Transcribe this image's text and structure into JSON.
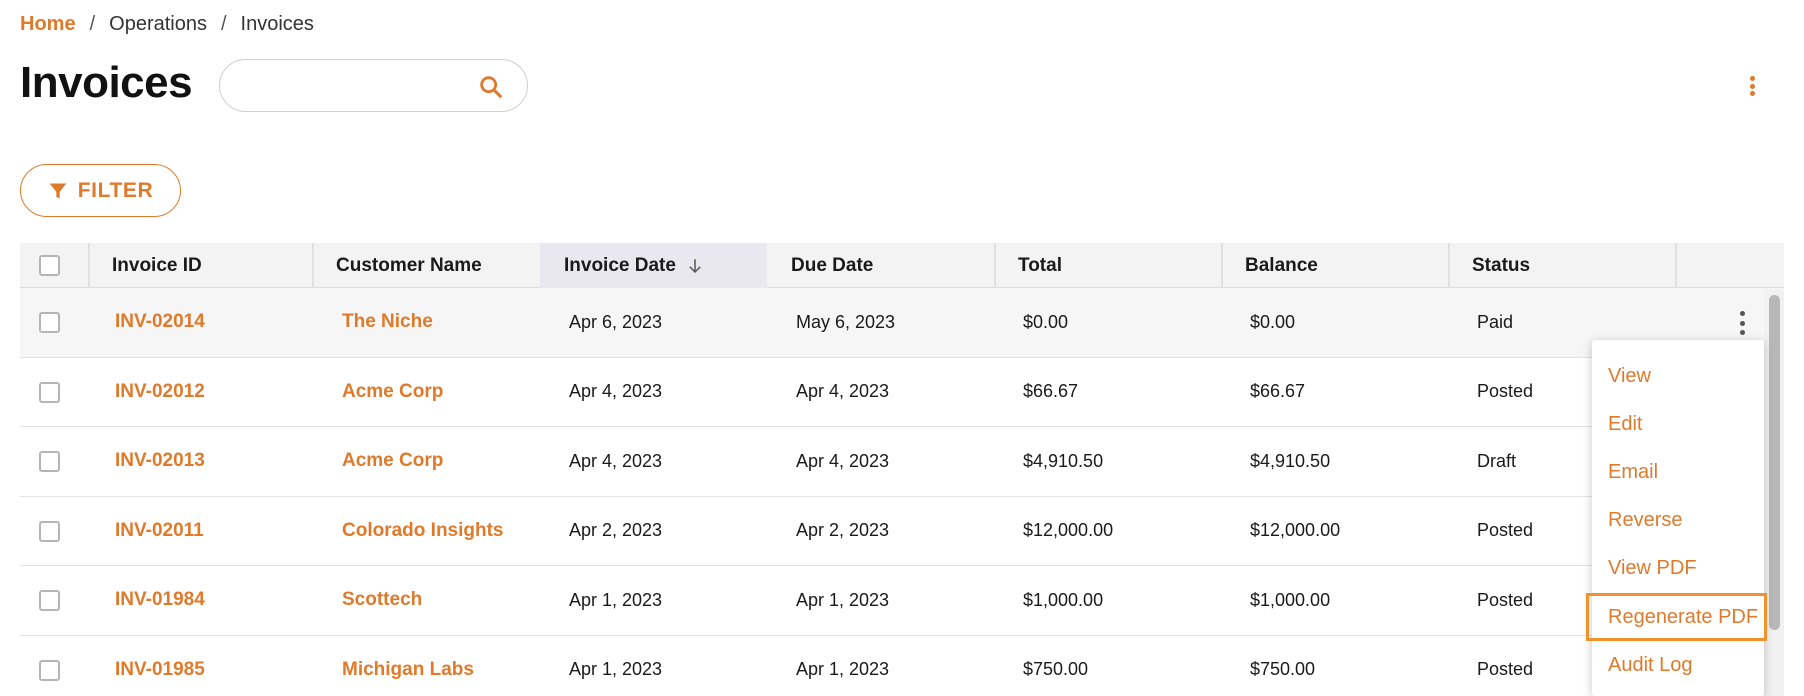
{
  "breadcrumb": {
    "home": "Home",
    "separator": "/",
    "items": [
      "Operations",
      "Invoices"
    ]
  },
  "page": {
    "title": "Invoices"
  },
  "search": {
    "value": "",
    "placeholder": "",
    "icon": "search-icon"
  },
  "filter": {
    "label": "FILTER",
    "icon": "filter-icon"
  },
  "colors": {
    "accent": "#e07a2b",
    "focus_border": "#f0932b",
    "header_bg": "#f3f3f3",
    "sorted_header_bg": "#e8e8ee"
  },
  "table": {
    "columns": [
      "Invoice ID",
      "Customer Name",
      "Invoice Date",
      "Due Date",
      "Total",
      "Balance",
      "Status"
    ],
    "sorted_column": "Invoice Date",
    "sort_direction": "descending",
    "rows": [
      {
        "id": "INV-02014",
        "customer": "The Niche",
        "invoice_date": "Apr 6, 2023",
        "due_date": "May 6, 2023",
        "total": "$0.00",
        "balance": "$0.00",
        "status": "Paid"
      },
      {
        "id": "INV-02012",
        "customer": "Acme Corp",
        "invoice_date": "Apr 4, 2023",
        "due_date": "Apr 4, 2023",
        "total": "$66.67",
        "balance": "$66.67",
        "status": "Posted"
      },
      {
        "id": "INV-02013",
        "customer": "Acme Corp",
        "invoice_date": "Apr 4, 2023",
        "due_date": "Apr 4, 2023",
        "total": "$4,910.50",
        "balance": "$4,910.50",
        "status": "Draft"
      },
      {
        "id": "INV-02011",
        "customer": "Colorado Insights",
        "invoice_date": "Apr 2, 2023",
        "due_date": "Apr 2, 2023",
        "total": "$12,000.00",
        "balance": "$12,000.00",
        "status": "Posted"
      },
      {
        "id": "INV-01984",
        "customer": "Scottech",
        "invoice_date": "Apr 1, 2023",
        "due_date": "Apr 1, 2023",
        "total": "$1,000.00",
        "balance": "$1,000.00",
        "status": "Posted"
      },
      {
        "id": "INV-01985",
        "customer": "Michigan Labs",
        "invoice_date": "Apr 1, 2023",
        "due_date": "Apr 1, 2023",
        "total": "$750.00",
        "balance": "$750.00",
        "status": "Posted"
      }
    ]
  },
  "row_menu": {
    "items": [
      "View",
      "Edit",
      "Email",
      "Reverse",
      "View PDF",
      "Regenerate PDF",
      "Audit Log"
    ],
    "focused_item": "Regenerate PDF"
  }
}
